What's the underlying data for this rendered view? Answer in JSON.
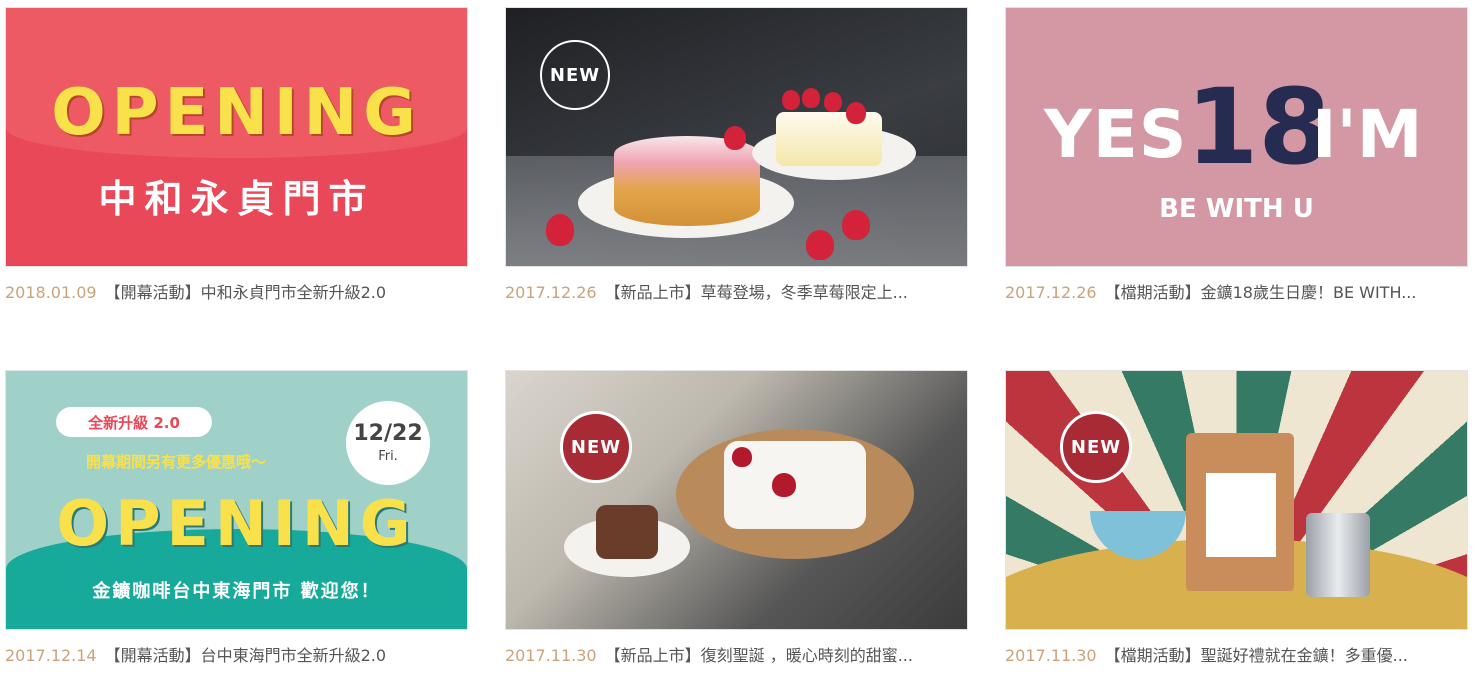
{
  "cards": [
    {
      "date": "2018.01.09",
      "title": "【開幕活動】中和永貞門市全新升級2.0",
      "banner": {
        "heading": "OPENING",
        "subheading": "中和永貞門市"
      }
    },
    {
      "date": "2017.12.26",
      "title": "【新品上市】草莓登場，冬季草莓限定上...",
      "banner": {
        "badge": "NEW"
      }
    },
    {
      "date": "2017.12.26",
      "title": "【檔期活動】金鑛18歲生日慶！BE WITH...",
      "banner": {
        "yes": "YES",
        "number": "18",
        "im": "I'M",
        "tagline": "BE WITH U"
      }
    },
    {
      "date": "2017.12.14",
      "title": "【開幕活動】台中東海門市全新升級2.0",
      "banner": {
        "pill": "全新升級 2.0",
        "promo": "開幕期間另有更多優惠哦～",
        "bubble_date": "12/22",
        "bubble_day": "Fri.",
        "heading": "OPENING",
        "welcome": "金鑛咖啡台中東海門市 歡迎您！"
      }
    },
    {
      "date": "2017.11.30",
      "title": "【新品上市】復刻聖誕 ，暖心時刻的甜蜜...",
      "banner": {
        "badge": "NEW"
      }
    },
    {
      "date": "2017.11.30",
      "title": "【檔期活動】聖誕好禮就在金鑛！多重優...",
      "banner": {
        "badge": "NEW"
      }
    }
  ],
  "colors": {
    "date": "#c9a37a",
    "title": "#555555",
    "red_banner": "#e94858",
    "pink_banner": "#d497a4",
    "teal_banner": "#17a99a",
    "yellow_text": "#f9e14b",
    "navy": "#262b52"
  }
}
